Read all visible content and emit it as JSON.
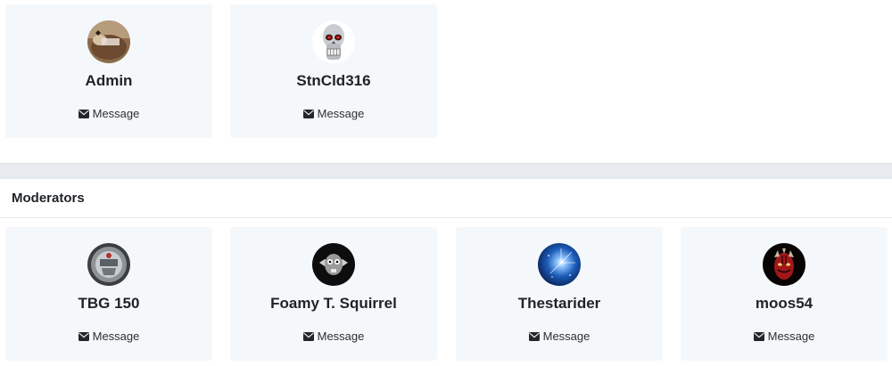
{
  "admins": [
    {
      "username": "Admin",
      "message_label": "Message",
      "avatar": "photo-avatar"
    },
    {
      "username": "StnCld316",
      "message_label": "Message",
      "avatar": "skull-avatar"
    }
  ],
  "moderators_section": {
    "title": "Moderators"
  },
  "moderators": [
    {
      "username": "TBG 150",
      "message_label": "Message",
      "avatar": "emblem-avatar"
    },
    {
      "username": "Foamy T. Squirrel",
      "message_label": "Message",
      "avatar": "squirrel-avatar"
    },
    {
      "username": "Thestarider",
      "message_label": "Message",
      "avatar": "starburst-avatar"
    },
    {
      "username": "moos54",
      "message_label": "Message",
      "avatar": "red-face-avatar"
    }
  ],
  "icons": {
    "message": "envelope-icon"
  },
  "colors": {
    "card_bg": "#f5f8fb",
    "divider_band": "#e7ebef",
    "text": "#1f2328"
  }
}
